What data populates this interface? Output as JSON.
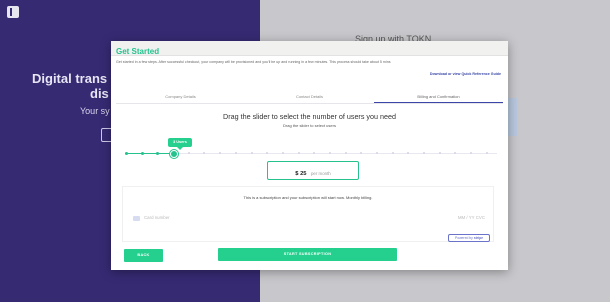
{
  "background": {
    "heading": "Digital trans",
    "heading_line2": "dis",
    "subtext": "Your sy",
    "signup_label": "Sign up with TOKN"
  },
  "modal": {
    "title": "Get Started",
    "intro": "Get started in a few steps. After successful checkout, your company will be provisioned and you'll be up and running in a few minutes. This process should take about 5 mins",
    "guide_link": "Download or view Quick Reference Guide"
  },
  "tabs": [
    {
      "label": "Company Details",
      "active": false
    },
    {
      "label": "Contact Details",
      "active": false
    },
    {
      "label": "Billing and Confirmation",
      "active": true
    }
  ],
  "slider": {
    "title": "Drag the slider to select the number of users you need",
    "subtitle": "Drag the slider to select users",
    "badge": "3 Users",
    "value": 3,
    "steps": 24
  },
  "price": {
    "amount": "$ 25",
    "unit": "per month"
  },
  "subscription": {
    "note": "This is a subscription and your subscription will start now. Monthly billing.",
    "card_placeholder": "Card number",
    "exp_placeholder": "MM / YY  CVC",
    "powered_by": "Powered by",
    "powered_brand": "stripe"
  },
  "buttons": {
    "back": "BACK",
    "start": "START SUBSCRIPTION"
  },
  "colors": {
    "accent": "#25c28e",
    "brand_purple": "#362a73",
    "link_blue": "#3a47a8"
  }
}
